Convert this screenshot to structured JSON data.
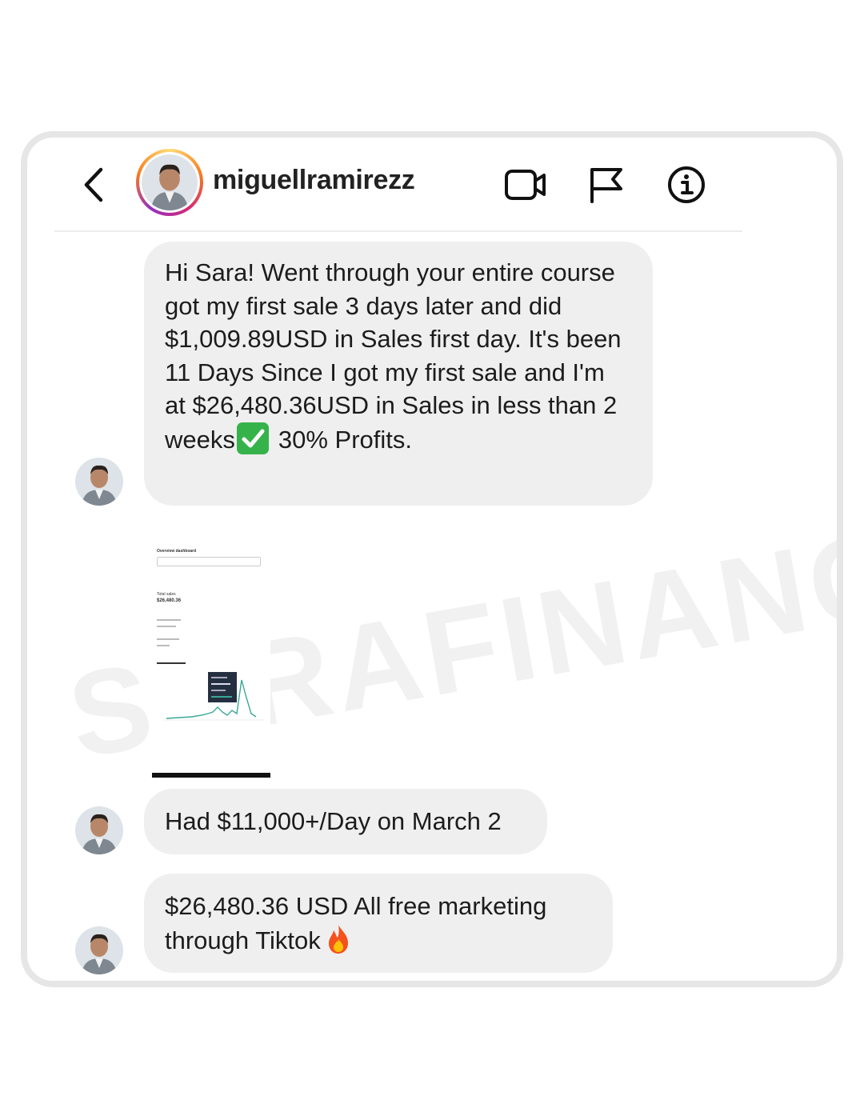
{
  "header": {
    "username": "miguellramirezz",
    "icons": [
      "back-icon",
      "video-call-icon",
      "flag-icon",
      "info-icon"
    ]
  },
  "messages": [
    {
      "text_before_check": "Hi Sara! Went through your entire course got my first sale 3 days later and did $1,009.89USD in Sales first day. It's been 11 Days Since I got my first sale and I'm at $26,480.36USD in Sales in less than 2 weeks",
      "check_icon": "check-mark-icon",
      "text_after_check": "30% Profits."
    },
    {
      "dashboard_title": "Overview dashboard",
      "total_sales_label": "Total sales",
      "total_sales_value": "$26,480.36"
    },
    {
      "text": "Had $11,000+/Day on March 2"
    },
    {
      "text": "$26,480.36 USD All free marketing through Tiktok",
      "emoji_icon": "fire-icon"
    }
  ],
  "watermark": "SARAFINANCE",
  "colors": {
    "bubble": "#efefef",
    "card_border": "#e6e6e6",
    "check_green": "#35b34a",
    "chart_line": "#3aa796"
  }
}
